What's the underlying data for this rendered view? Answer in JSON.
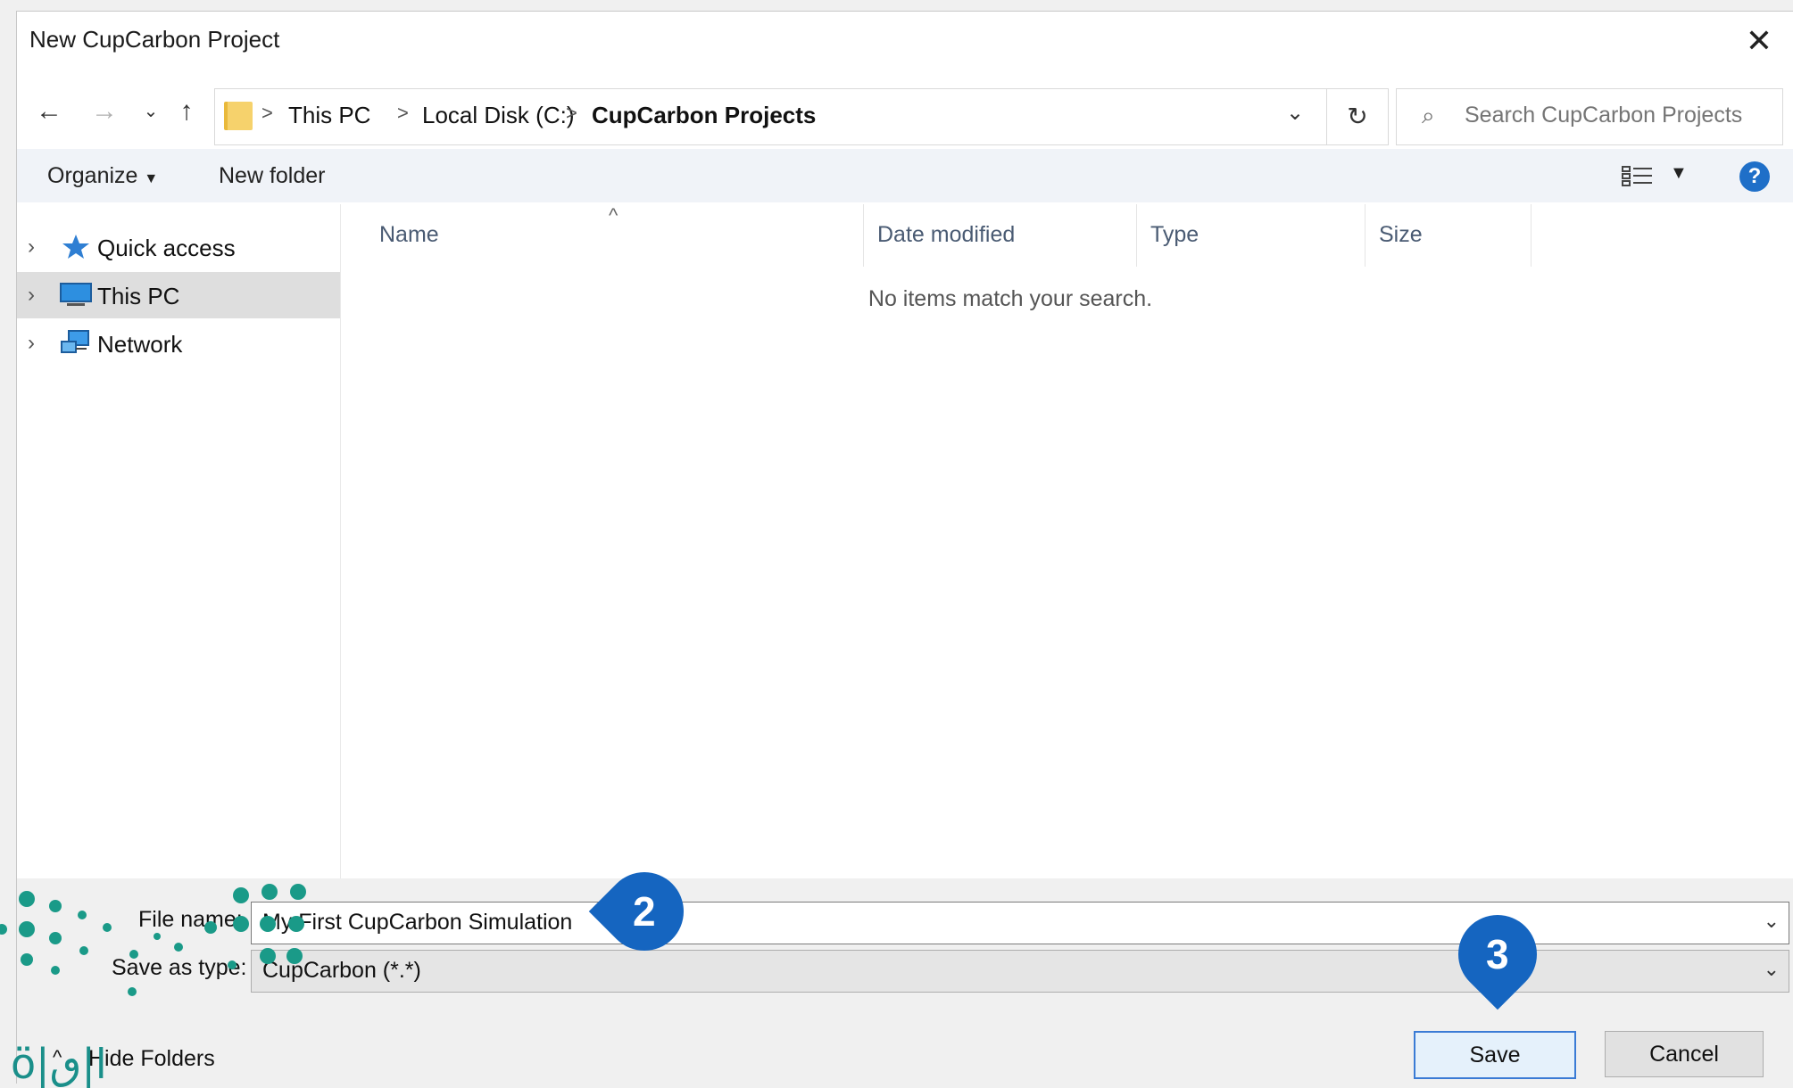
{
  "window": {
    "title": "New CupCarbon Project"
  },
  "address": {
    "crumbs": [
      "This PC",
      "Local Disk (C:)",
      "CupCarbon Projects"
    ],
    "separator": ">"
  },
  "search": {
    "placeholder": "Search CupCarbon Projects"
  },
  "toolbar": {
    "organize": "Organize",
    "new_folder": "New folder"
  },
  "nav": {
    "items": [
      {
        "label": "Quick access",
        "icon": "star-icon"
      },
      {
        "label": "This PC",
        "icon": "computer-icon",
        "selected": true
      },
      {
        "label": "Network",
        "icon": "network-icon"
      }
    ]
  },
  "columns": [
    "Name",
    "Date modified",
    "Type",
    "Size"
  ],
  "content": {
    "empty_message": "No items match your search."
  },
  "form": {
    "file_name_label": "File name:",
    "file_name_value": "My First CupCarbon Simulation",
    "save_as_type_label": "Save as type:",
    "save_as_type_value": "CupCarbon (*.*)"
  },
  "buttons": {
    "save": "Save",
    "cancel": "Cancel",
    "hide_folders": "Hide Folders"
  },
  "callouts": [
    "2",
    "3"
  ],
  "colors": {
    "accent": "#1565c0",
    "help": "#1f6fc8",
    "folder": "#f6d26c",
    "watermark": "#1a8f8a"
  }
}
